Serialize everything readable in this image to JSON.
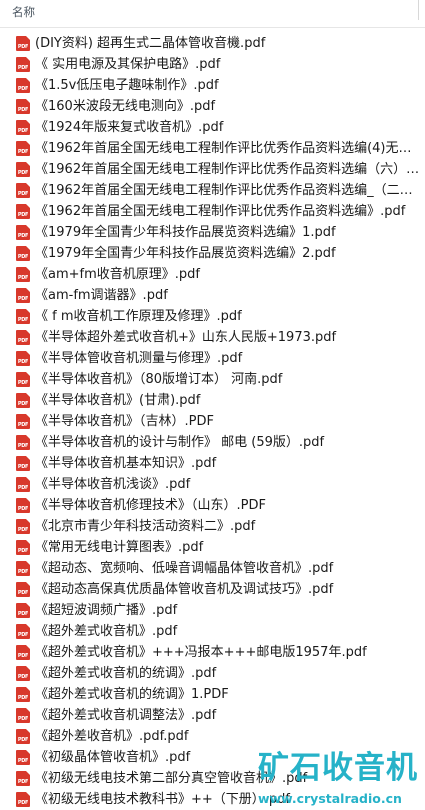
{
  "header": {
    "column_name": "名称"
  },
  "icon": {
    "file_type_icon": "pdf-file-icon",
    "icon_text": "PDF",
    "icon_color": "#d8382b"
  },
  "files": [
    "(DIY资料) 超再生式二晶体管收音機.pdf",
    "《 实用电源及其保护电路》.pdf",
    "《1.5v低压电子趣味制作》.pdf",
    "《160米波段无线电测向》.pdf",
    "《1924年版来复式收音机》.pdf",
    "《1962年首届全国无线电工程制作评比优秀作品资料选编(4)无线电测...",
    "《1962年首届全国无线电工程制作评比优秀作品资料选编（六）电子...",
    "《1962年首届全国无线电工程制作评比优秀作品资料选编_（二）_电...",
    "《1962年首届全国无线电工程制作评比优秀作品资料选编》.pdf",
    "《1979年全国青少年科技作品展览资料选编》1.pdf",
    "《1979年全国青少年科技作品展览资料选编》2.pdf",
    "《am+fm收音机原理》.pdf",
    "《am-fm调谐器》.pdf",
    "《 f m收音机工作原理及修理》.pdf",
    "《半导体超外差式收音机+》山东人民版+1973.pdf",
    "《半导体管收音机测量与修理》.pdf",
    "《半导体收音机》（80版增订本） 河南.pdf",
    "《半导体收音机》(甘肃).pdf",
    "《半导体收音机》（吉林）.PDF",
    "《半导体收音机的设计与制作》 邮电 (59版）.pdf",
    "《半导体收音机基本知识》.pdf",
    "《半导体收音机浅谈》.pdf",
    "《半导体收音机修理技术》（山东）.PDF",
    "《北京市青少年科技活动资料二》.pdf",
    "《常用无线电计算图表》.pdf",
    "《超动态、宽频响、低噪音调幅晶体管收音机》.pdf",
    "《超动态高保真优质晶体管收音机及调试技巧》.pdf",
    "《超短波调频广播》.pdf",
    "《超外差式收音机》.pdf",
    "《超外差式收音机》+++冯报本+++邮电版1957年.pdf",
    "《超外差式收音机的统调》.pdf",
    "《超外差式收音机的统调》1.PDF",
    "《超外差式收音机调整法》.pdf",
    "《超外差收音机》.pdf.pdf",
    "《初级晶体管收音机》.pdf",
    "《初级无线电技术第二部分真空管收音机》.pdf",
    "《初级无线电技术教科书》++（下册）.pdf"
  ],
  "watermark": {
    "brand": "矿石收音机",
    "url": "www.crystalradio.cn",
    "color": "#26b2c8"
  }
}
